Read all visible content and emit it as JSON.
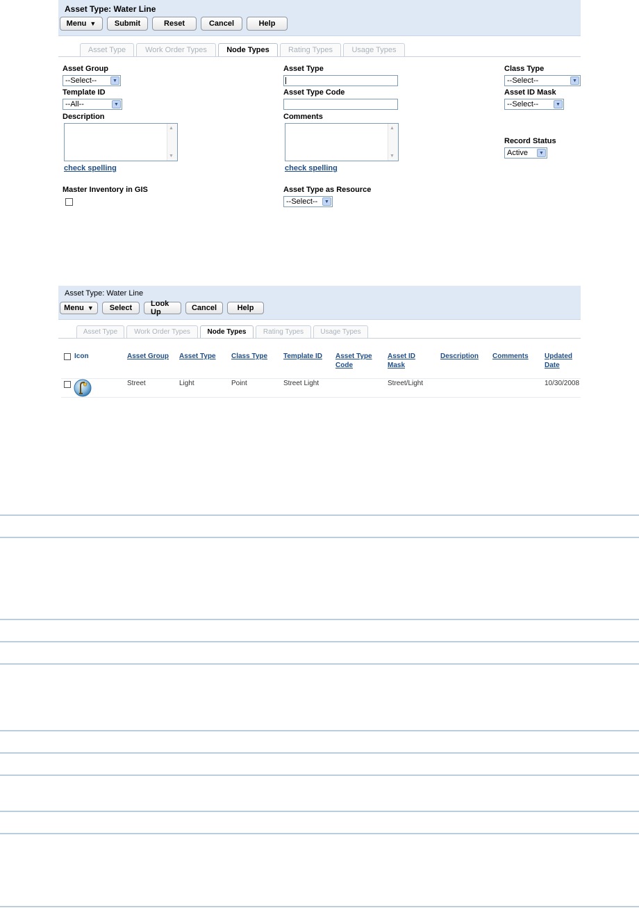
{
  "form": {
    "title": "Asset Type: Water Line",
    "toolbar": {
      "menu": "Menu",
      "submit": "Submit",
      "reset": "Reset",
      "cancel": "Cancel",
      "help": "Help"
    },
    "tabs": [
      "Asset Type",
      "Work Order Types",
      "Node Types",
      "Rating Types",
      "Usage Types"
    ],
    "fields": {
      "asset_group_label": "Asset Group",
      "asset_group_value": "--Select--",
      "template_id_label": "Template ID",
      "template_id_value": "--All--",
      "description_label": "Description",
      "asset_type_label": "Asset Type",
      "asset_type_value": "",
      "asset_type_code_label": "Asset Type Code",
      "asset_type_code_value": "",
      "comments_label": "Comments",
      "class_type_label": "Class Type",
      "class_type_value": "--Select--",
      "asset_id_mask_label": "Asset ID Mask",
      "asset_id_mask_value": "--Select--",
      "record_status_label": "Record Status",
      "record_status_value": "Active",
      "check_spelling": "check spelling",
      "master_inventory_label": "Master Inventory in GIS",
      "asset_type_resource_label": "Asset Type as Resource",
      "asset_type_resource_value": "--Select--"
    }
  },
  "list": {
    "title": "Asset Type: Water Line",
    "toolbar": {
      "menu": "Menu",
      "select": "Select",
      "lookup": "Look Up",
      "cancel": "Cancel",
      "help": "Help"
    },
    "tabs": [
      "Asset Type",
      "Work Order Types",
      "Node Types",
      "Rating Types",
      "Usage Types"
    ],
    "columns": [
      "Icon",
      "Asset Group",
      "Asset Type",
      "Class Type",
      "Template ID",
      "Asset Type Code",
      "Asset ID Mask",
      "Description",
      "Comments",
      "Updated Date"
    ],
    "rows": [
      {
        "asset_group": "Street",
        "asset_type": "Light",
        "class_type": "Point",
        "template_id": "Street Light",
        "asset_type_code": "",
        "asset_id_mask": "Street/Light",
        "description": "",
        "comments": "",
        "updated_date": "10/30/2008"
      }
    ]
  },
  "colors": {
    "header_bg": "#dfe9f5",
    "link": "#1f4e86",
    "rule": "#b9cfde"
  },
  "icons": {
    "caret": "menu-caret-icon",
    "dropdown": "dropdown-arrow-icon",
    "asset": "streetlight-icon"
  }
}
